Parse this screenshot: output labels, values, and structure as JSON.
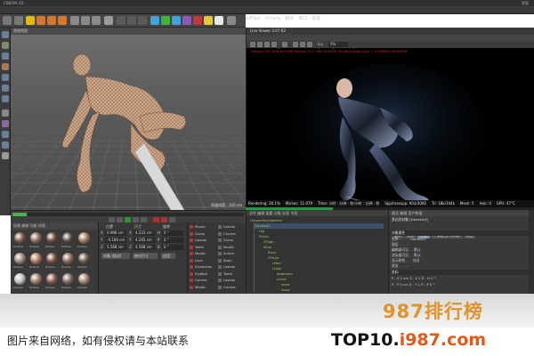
{
  "window": {
    "title": "CINEMA 4D",
    "status": "界面"
  },
  "menubar": {
    "items": [
      "文件",
      "编辑",
      "创建",
      "选择",
      "工具",
      "网格",
      "捕捉",
      "动画",
      "模拟",
      "渲染",
      "雕刻",
      "运动跟踪",
      "运动图形",
      "角色",
      "流水线",
      "插件",
      "RealFlow",
      "Octane",
      "脚本",
      "窗口",
      "帮助"
    ]
  },
  "viewport": {
    "label": "透视视图",
    "footer": "网格间距 : 100 cm"
  },
  "live_viewer": {
    "title": "Live Viewer 3.07-R2",
    "menu": [
      "File",
      "Cloud",
      "Objects",
      "Materials",
      "Compare",
      "Options",
      "Help",
      "GUI"
    ],
    "info": "Geforce GTX 1080 8192MB Geforce GTX 1080 8192MB Used/free/total vram: 1.543MB/6.538GB/8GB",
    "status": [
      "Rendering: 30.1%",
      "Ms/sec: 11.079",
      "Time: 小时 : 分钟 : 秒/小时 : 分钟 : 秒",
      "Spp/maxspp: 903/3000",
      "Tri: 18k/344k",
      "Mesh: 5",
      "Hair: 0",
      "GPU: 47°C"
    ],
    "progress": 0.301,
    "zoom_label": "Liu",
    "zoom_value": "5%"
  },
  "materials": {
    "menu": "创建 编辑 功能 纹理",
    "names": [
      "Octane",
      "Octane",
      "Octane",
      "Octane",
      "Octane",
      "Octane",
      "Octane",
      "Octane",
      "Octane",
      "Octane",
      "Octane",
      "Octane",
      "Octane",
      "Octane",
      "Octane"
    ]
  },
  "coords": {
    "headers": [
      "位置",
      "尺寸",
      "旋转"
    ],
    "rows": [
      [
        "X",
        "0.996 cm",
        "X",
        "4.233 cm",
        "H",
        "0 °"
      ],
      [
        "Y",
        "-4.169 cm",
        "Y",
        "4.245 cm",
        "P",
        "0 °"
      ],
      [
        "Z",
        "5.568 cm",
        "Z",
        "4.568 cm",
        "B",
        "0 °"
      ]
    ],
    "mode": "对象 (相对)",
    "size_mode": "绝对尺寸",
    "apply": "应用"
  },
  "object_list": {
    "left": [
      "Mouth",
      "Gums",
      "Lashes",
      "Teeth",
      "Mouth",
      "Liver",
      "Eyelashes",
      "EyeBall",
      "Cornea",
      "Mouth"
    ],
    "right": [
      "Lashes",
      "Cornea",
      "Gums",
      "Mouth",
      "Sclera",
      "Body",
      "Lashes",
      "Teeth",
      "Lashes",
      "Cornea"
    ]
  },
  "object_tree": {
    "header": "文件 编辑 查看 对象 标签 书签",
    "rows": [
      "OctaneSkyMaterial",
      "Genesis3",
      "Hip",
      "Pelvis",
      "lThigh",
      "lShin",
      "lFoot",
      "rThigh",
      "rShin",
      "rFoot",
      "abdomen",
      "chest",
      "neck",
      "head"
    ]
  },
  "attributes": {
    "header": "模式 编辑 用户数据",
    "object": "多边形对象 [Genesis3]",
    "tabs": [
      "基本",
      "坐标",
      "对象",
      "平滑着色(Phong)",
      "标签"
    ],
    "section_basic": "对象属性",
    "rows": [
      "名称 . . . . . Genesis3",
      "图层 . . . . .",
      "编辑器可见 . . 默认",
      "渲染器可见 . . 默认",
      "显示颜色 . . . 关闭",
      "透显 . . . . ."
    ],
    "section_coord": "坐标",
    "coord_rows": [
      "P . X 0 cm   S . X 1   R . H 0 °",
      "P . Y 0 cm   S . Y 1   R . P 0 °"
    ]
  },
  "watermark": {
    "logo": "987排行榜"
  },
  "footer": {
    "disclaimer": "图片来自网络，如有侵权请与本站联系",
    "brand_part1": "TOP10.",
    "brand_part2": "i987.com"
  }
}
